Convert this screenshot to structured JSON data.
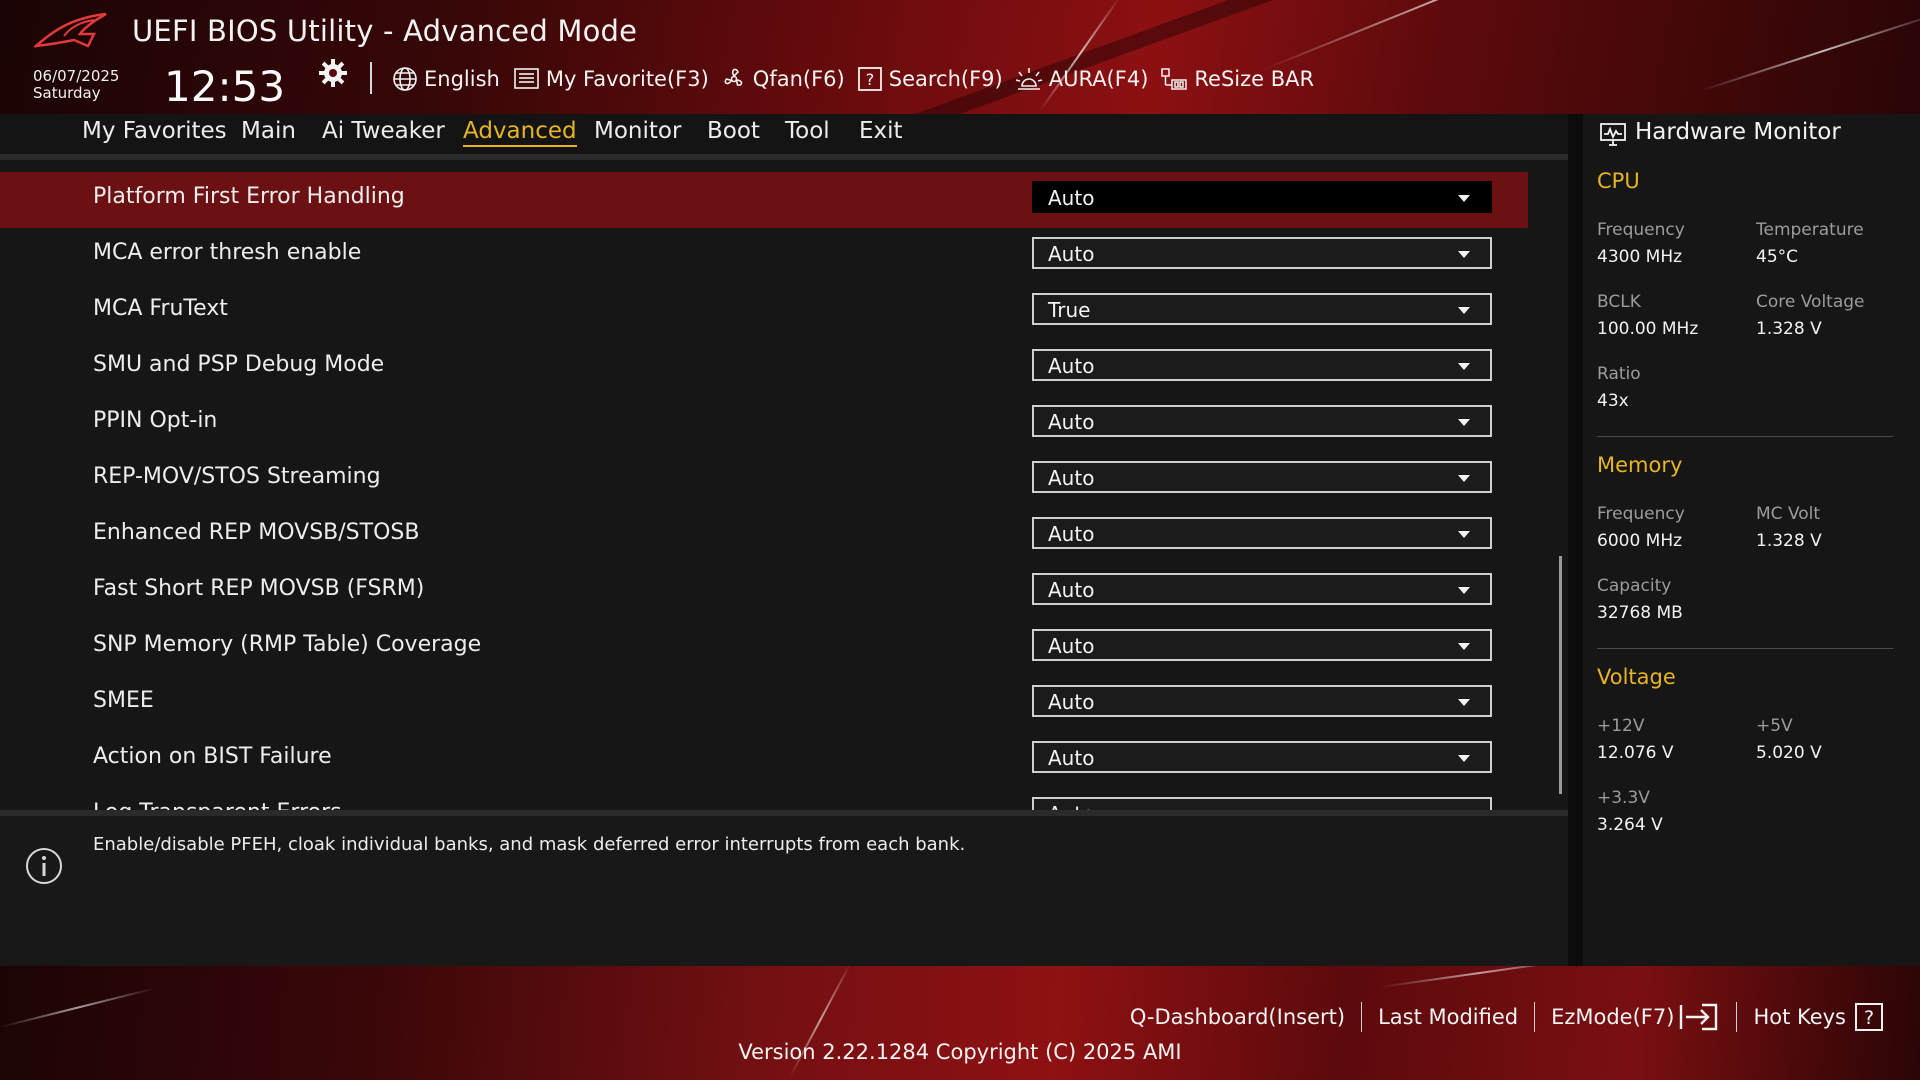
{
  "header": {
    "title": "UEFI BIOS Utility - Advanced Mode",
    "date": "06/07/2025",
    "day": "Saturday",
    "time": "12:53",
    "toolbar": [
      {
        "label": "English",
        "icon": "globe-icon"
      },
      {
        "label": "My Favorite(F3)",
        "icon": "favorite-list-icon"
      },
      {
        "label": "Qfan(F6)",
        "icon": "fan-icon"
      },
      {
        "label": "Search(F9)",
        "icon": "search-help-icon"
      },
      {
        "label": "AURA(F4)",
        "icon": "aura-light-icon"
      },
      {
        "label": "ReSize BAR",
        "icon": "resize-bar-icon"
      }
    ]
  },
  "nav": {
    "tabs": [
      "My Favorites",
      "Main",
      "Ai Tweaker",
      "Advanced",
      "Monitor",
      "Boot",
      "Tool",
      "Exit"
    ],
    "active": "Advanced"
  },
  "settings": [
    {
      "label": "Platform First Error Handling",
      "value": "Auto",
      "selected": true
    },
    {
      "label": "MCA error thresh enable",
      "value": "Auto"
    },
    {
      "label": "MCA FruText",
      "value": "True"
    },
    {
      "label": "SMU and PSP Debug Mode",
      "value": "Auto"
    },
    {
      "label": "PPIN Opt-in",
      "value": "Auto"
    },
    {
      "label": "REP-MOV/STOS Streaming",
      "value": "Auto"
    },
    {
      "label": "Enhanced REP MOVSB/STOSB",
      "value": "Auto"
    },
    {
      "label": "Fast Short REP MOVSB (FSRM)",
      "value": "Auto"
    },
    {
      "label": "SNP Memory (RMP Table) Coverage",
      "value": "Auto"
    },
    {
      "label": "SMEE",
      "value": "Auto"
    },
    {
      "label": "Action on BIST Failure",
      "value": "Auto"
    },
    {
      "label": "Log Transparent Errors",
      "value": "Auto"
    }
  ],
  "help": {
    "text": "Enable/disable PFEH, cloak individual banks, and mask deferred error interrupts from each bank."
  },
  "hardware_monitor": {
    "title": "Hardware Monitor",
    "cpu": {
      "heading": "CPU",
      "frequency_label": "Frequency",
      "frequency": "4300 MHz",
      "temperature_label": "Temperature",
      "temperature": "45°C",
      "bclk_label": "BCLK",
      "bclk": "100.00 MHz",
      "core_voltage_label": "Core Voltage",
      "core_voltage": "1.328 V",
      "ratio_label": "Ratio",
      "ratio": "43x"
    },
    "memory": {
      "heading": "Memory",
      "frequency_label": "Frequency",
      "frequency": "6000 MHz",
      "mc_volt_label": "MC Volt",
      "mc_volt": "1.328 V",
      "capacity_label": "Capacity",
      "capacity": "32768 MB"
    },
    "voltage": {
      "heading": "Voltage",
      "v12_label": "+12V",
      "v12": "12.076 V",
      "v5_label": "+5V",
      "v5": "5.020 V",
      "v33_label": "+3.3V",
      "v33": "3.264 V"
    }
  },
  "footer": {
    "buttons": [
      "Q-Dashboard(Insert)",
      "Last Modified",
      "EzMode(F7)",
      "Hot Keys"
    ],
    "version": "Version 2.22.1284 Copyright (C) 2025 AMI"
  },
  "colors": {
    "accent": "#e8b424",
    "selected_row": "#6b1114",
    "brand_red": "#8c1012"
  }
}
